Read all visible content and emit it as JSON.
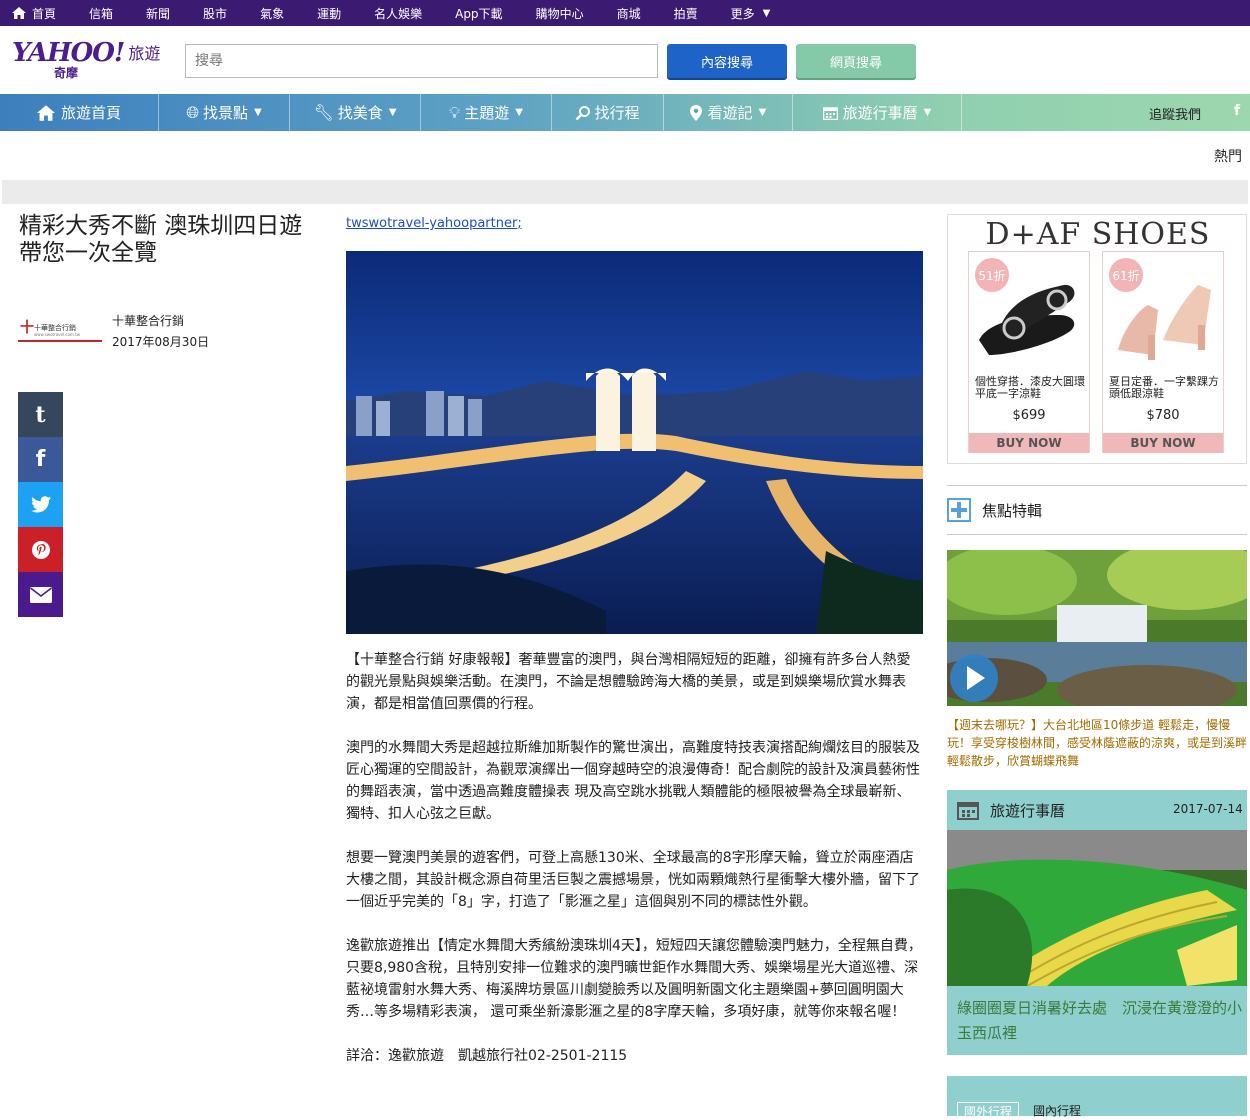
{
  "topbar": {
    "items": [
      "首頁",
      "信箱",
      "新聞",
      "股市",
      "氣象",
      "運動",
      "名人娛樂",
      "App下載",
      "購物中心",
      "商城",
      "拍賣",
      "更多"
    ]
  },
  "header": {
    "logo_text": "YAHOO!",
    "logo_sub": "奇摩",
    "section_name": "旅遊",
    "search_placeholder": "搜尋",
    "btn_content": "內容搜尋",
    "btn_web": "網頁搜尋"
  },
  "nav": {
    "items": [
      {
        "label": "旅遊首頁",
        "icon": "home-icon"
      },
      {
        "label": "找景點",
        "icon": "globe-icon",
        "dropdown": true
      },
      {
        "label": "找美食",
        "icon": "wrench-icon",
        "dropdown": true
      },
      {
        "label": "主題遊",
        "icon": "bulb-icon",
        "dropdown": true
      },
      {
        "label": "找行程",
        "icon": "search-icon"
      },
      {
        "label": "看遊記",
        "icon": "map-pin-icon",
        "dropdown": true
      },
      {
        "label": "旅遊行事曆",
        "icon": "calendar-icon",
        "dropdown": true
      }
    ],
    "follow": "追蹤我們",
    "facebook": "f"
  },
  "hot_label": "熱門",
  "article": {
    "title": "精彩大秀不斷 澳珠圳四日遊帶您一次全覽",
    "author": "十華整合行銷",
    "date": "2017年08月30日",
    "source_link": "twswotravel-yahoopartner",
    "source_suffix": ";",
    "paragraphs": [
      "【十華整合行銷 好康報報】奢華豐富的澳門，與台灣相隔短短的距離，卻擁有許多台人熱愛的觀光景點與娛樂活動。在澳門，不論是想體驗跨海大橋的美景，或是到娛樂場欣賞水舞表演，都是相當值回票價的行程。",
      "澳門的水舞間大秀是超越拉斯維加斯製作的驚世演出，高難度特技表演搭配絢爛炫目的服裝及匠心獨運的空間設計，為觀眾演繹出一個穿越時空的浪漫傳奇！配合劇院的設計及演員藝術性的舞蹈表演，當中透過高難度體操表 現及高空跳水挑戰人類體能的極限被譽為全球最嶄新、獨特、扣人心弦之巨獻。",
      "想要一覽澳門美景的遊客們，可登上高懸130米、全球最高的8字形摩天輪，聳立於兩座酒店大樓之間，其設計概念源自荷里活巨製之震撼場景，恍如兩顆熾熱行星衝擊大樓外牆，留下了一個近乎完美的「8」字，打造了「影滙之星」這個與別不同的標誌性外觀。",
      "逸歡旅遊推出【情定水舞間大秀繽紛澳珠圳4天】，短短四天讓您體驗澳門魅力，全程無自費，只要8,980含稅，且特別安排一位難求的澳門曠世鉅作水舞間大秀、娛樂場星光大道巡禮、深藍祕境雷射水舞大秀、梅溪牌坊景區川劇變臉秀以及圓明新園文化主題樂園+夢回圓明園大秀…等多場精彩表演， 還可乘坐新濠影滙之星的8字摩天輪，多項好康，就等你來報名喔！",
      "詳洽：逸歡旅遊　凱越旅行社02-2501-2115"
    ]
  },
  "share": [
    {
      "name": "tumblr",
      "glyph": "t",
      "color": "#36465d"
    },
    {
      "name": "facebook",
      "glyph": "f",
      "color": "#3b5998"
    },
    {
      "name": "twitter",
      "glyph": "",
      "color": "#1da1f2"
    },
    {
      "name": "pinterest",
      "glyph": "",
      "color": "#cb2027"
    },
    {
      "name": "email",
      "glyph": "",
      "color": "#4b1a8c"
    }
  ],
  "ad": {
    "brand": "D+AF SHOES",
    "products": [
      {
        "badge": "51折",
        "desc": "個性穿搭．漆皮大圓環平底一字涼鞋",
        "price": "$699",
        "cta": "BUY NOW"
      },
      {
        "badge": "61折",
        "desc": "夏日定番．一字繫踝方頭低跟涼鞋",
        "price": "$780",
        "cta": "BUY NOW"
      }
    ]
  },
  "focus": {
    "title": "焦點特輯",
    "caption": "【週末去哪玩？】大台北地區10條步道 輕鬆走，慢慢玩！享受穿梭樹林間，感受林蔭遮蔽的涼爽，或是到溪畔輕鬆散步，欣賞蝴蝶飛舞"
  },
  "calendar": {
    "title": "旅遊行事曆",
    "date": "2017-07-14",
    "caption": "綠圈圈夏日消暑好去處　沉浸在黃澄澄的小玉西瓜裡"
  },
  "trip": {
    "tabs": [
      "國外行程",
      "國內行程"
    ]
  }
}
